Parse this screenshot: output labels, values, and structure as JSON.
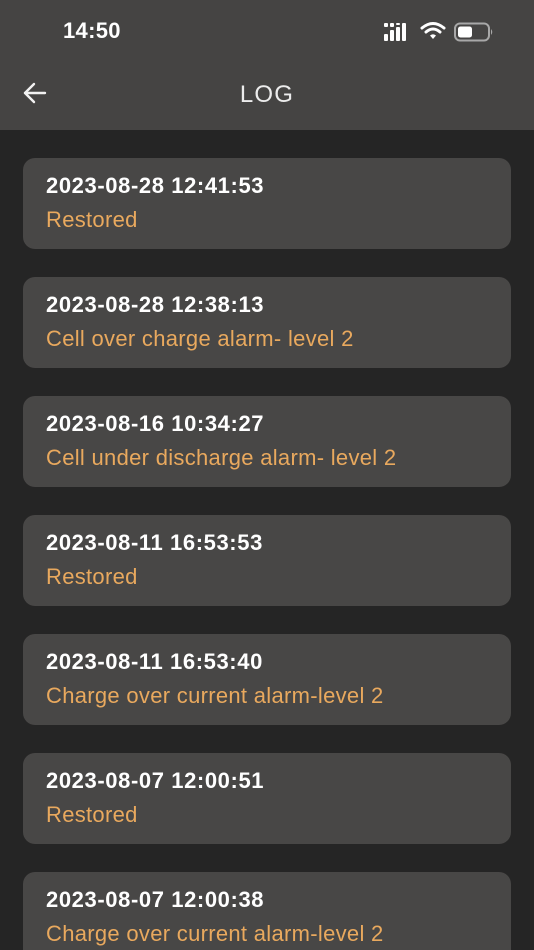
{
  "status_bar": {
    "time": "14:50",
    "icons": [
      "signal-icon",
      "wifi-icon",
      "battery-icon"
    ]
  },
  "header": {
    "back_icon": "arrow-left-icon",
    "title": "LOG"
  },
  "colors": {
    "background": "#252525",
    "header_background": "#454443",
    "card_background": "#484746",
    "timestamp_text": "#ffffff",
    "message_text": "#e9a95e"
  },
  "log_entries": [
    {
      "timestamp": "2023-08-28 12:41:53",
      "message": "Restored"
    },
    {
      "timestamp": "2023-08-28 12:38:13",
      "message": "Cell over charge alarm- level 2"
    },
    {
      "timestamp": "2023-08-16 10:34:27",
      "message": "Cell under discharge alarm- level 2"
    },
    {
      "timestamp": "2023-08-11 16:53:53",
      "message": "Restored"
    },
    {
      "timestamp": "2023-08-11 16:53:40",
      "message": "Charge over current alarm-level 2"
    },
    {
      "timestamp": "2023-08-07 12:00:51",
      "message": "Restored"
    },
    {
      "timestamp": "2023-08-07 12:00:38",
      "message": "Charge over current alarm-level 2"
    }
  ]
}
